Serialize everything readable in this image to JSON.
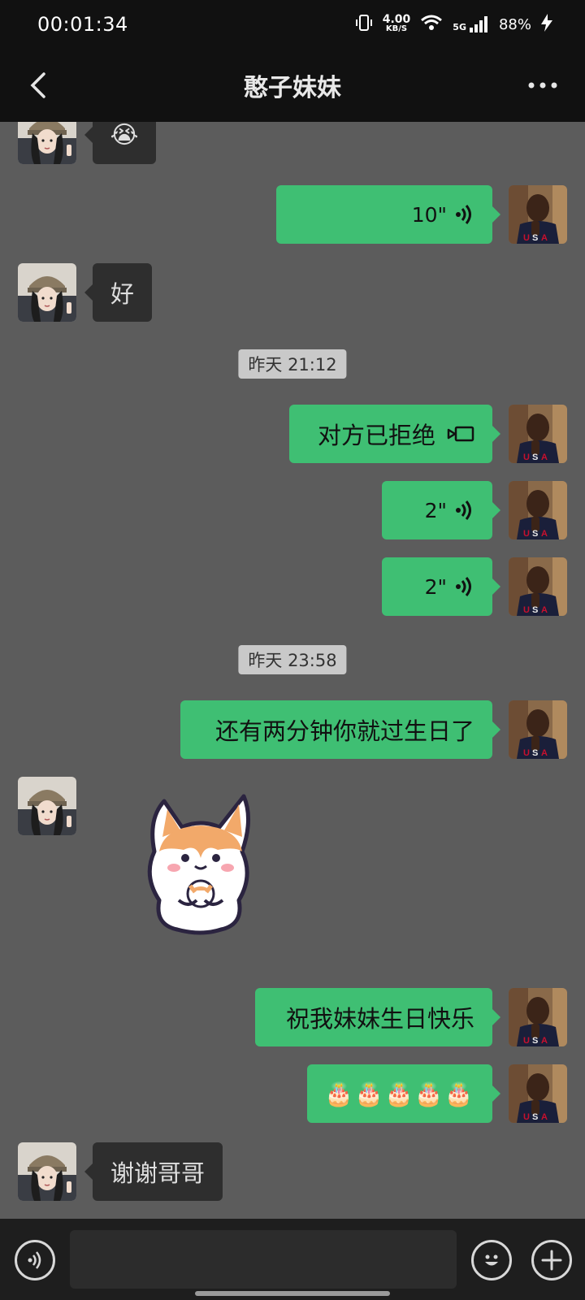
{
  "status_bar": {
    "time": "00:01:34",
    "net_speed_value": "4.00",
    "net_speed_unit": "KB/S",
    "network": "5G",
    "battery": "88%"
  },
  "header": {
    "title": "憨子妹妹",
    "back_icon": "chevron-left-icon",
    "more_icon": "more-dots-icon"
  },
  "messages": [
    {
      "side": "in",
      "type": "emoji",
      "content": "😭"
    },
    {
      "side": "out",
      "type": "voice",
      "duration": "10\""
    },
    {
      "side": "in",
      "type": "text",
      "content": "好"
    },
    {
      "type": "timestamp",
      "content": "昨天 21:12"
    },
    {
      "side": "out",
      "type": "call",
      "content": "对方已拒绝"
    },
    {
      "side": "out",
      "type": "voice",
      "duration": "2\""
    },
    {
      "side": "out",
      "type": "voice",
      "duration": "2\""
    },
    {
      "type": "timestamp",
      "content": "昨天 23:58"
    },
    {
      "side": "out",
      "type": "text",
      "content": "还有两分钟你就过生日了"
    },
    {
      "side": "in",
      "type": "sticker",
      "content": "corgi-sticker"
    },
    {
      "side": "out",
      "type": "text",
      "content": "祝我妹妹生日快乐"
    },
    {
      "side": "out",
      "type": "emoji",
      "content": "🎂🎂🎂🎂🎂"
    },
    {
      "side": "in",
      "type": "text",
      "content": "谢谢哥哥"
    }
  ],
  "input_bar": {
    "voice_icon": "voice-input-icon",
    "emoji_icon": "emoji-icon",
    "plus_icon": "plus-icon",
    "input_value": ""
  },
  "colors": {
    "chat_bg": "#5c5c5c",
    "outgoing_bubble": "#3fbf73",
    "incoming_bubble": "#2e2e2e",
    "header_bg": "#111111"
  }
}
